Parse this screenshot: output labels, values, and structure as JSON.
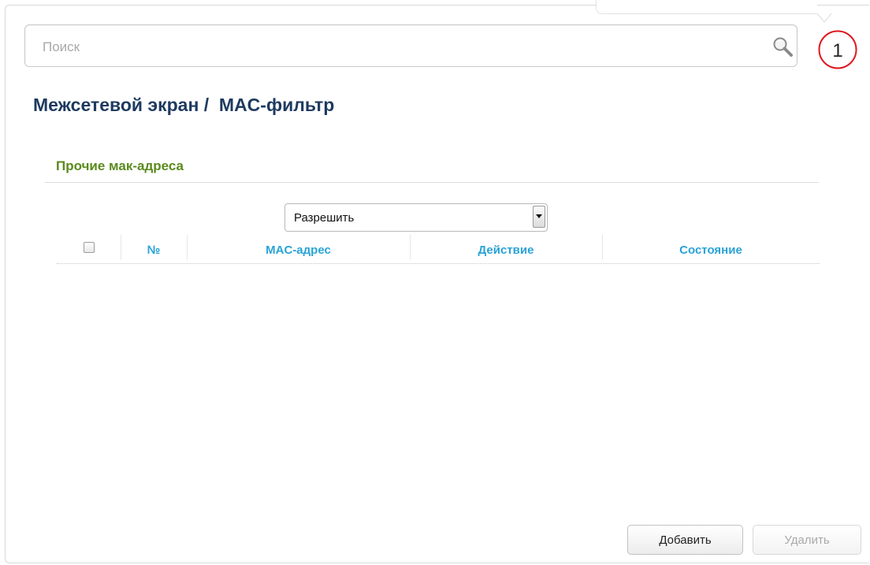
{
  "search": {
    "placeholder": "Поиск",
    "value": "",
    "icon": "search-icon"
  },
  "notifications": {
    "count": "1",
    "accent_color": "#e0161e"
  },
  "page": {
    "title": "Межсетевой экран /  MAC-фильтр"
  },
  "section": {
    "title": "Прочие мак-адреса"
  },
  "default_action": {
    "selected": "Разрешить"
  },
  "table": {
    "columns": [
      "№",
      "MAC-адрес",
      "Действие",
      "Состояние"
    ],
    "rows": [],
    "select_all_checked": false
  },
  "buttons": {
    "add": "Добавить",
    "delete": "Удалить",
    "delete_disabled": true
  },
  "colors": {
    "title": "#1e3a5f",
    "section_title": "#5b8a1e",
    "column_header": "#29a3d6"
  }
}
